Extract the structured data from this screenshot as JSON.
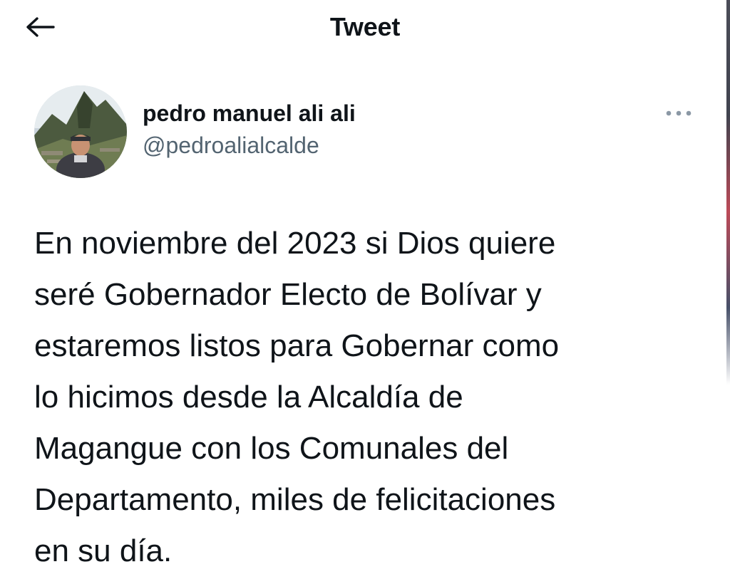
{
  "header": {
    "back_icon": "arrow-left-icon",
    "title": "Tweet"
  },
  "author": {
    "display_name": "pedro manuel ali ali",
    "handle": "@pedroalialcalde",
    "avatar_icon": "profile-photo",
    "more_icon": "more-horizontal-icon"
  },
  "tweet": {
    "text": "En noviembre del 2023 si Dios quiere\nseré Gobernador Electo de Bolívar y\nestaremos listos para Gobernar como\nlo hicimos desde la Alcaldía de\nMagangue con los Comunales del\nDepartamento, miles de felicitaciones\nen su día."
  },
  "colors": {
    "text_primary": "#0f1419",
    "text_secondary": "#536471",
    "background": "#ffffff"
  }
}
